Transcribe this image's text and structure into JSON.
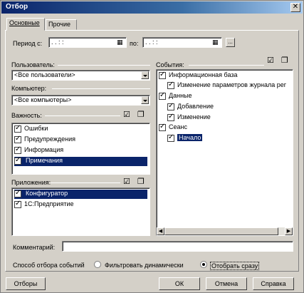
{
  "window": {
    "title": "Отбор"
  },
  "tabs": [
    {
      "label": "Основные"
    },
    {
      "label": "Прочие"
    }
  ],
  "period": {
    "from_label": "Период с:",
    "from_value": ". .      :  :",
    "to_label": "по:",
    "to_value": ". .      :  :",
    "more_button": "..."
  },
  "user": {
    "label": "Пользователь:",
    "value": "<Все пользователи>"
  },
  "computer": {
    "label": "Компьютер:",
    "value": "<Все компьютеры>"
  },
  "importance": {
    "label": "Важность:",
    "items": [
      {
        "label": "Ошибки",
        "checked": true
      },
      {
        "label": "Предупреждения",
        "checked": true
      },
      {
        "label": "Информация",
        "checked": true
      },
      {
        "label": "Примечания",
        "checked": true,
        "selected": true
      }
    ]
  },
  "applications": {
    "label": "Приложения:",
    "items": [
      {
        "label": "Конфигуратор",
        "checked": true,
        "selected": true
      },
      {
        "label": "1С:Предприятие",
        "checked": true
      }
    ]
  },
  "events": {
    "label": "События:",
    "items": [
      {
        "label": "Информационная база",
        "checked": true,
        "level": 0
      },
      {
        "label": "Изменение параметров журнала рег",
        "checked": true,
        "level": 1
      },
      {
        "label": "Данные",
        "checked": true,
        "level": 0
      },
      {
        "label": "Добавление",
        "checked": true,
        "level": 1
      },
      {
        "label": "Изменение",
        "checked": true,
        "level": 1
      },
      {
        "label": "Сеанс",
        "checked": true,
        "level": 0
      },
      {
        "label": "Начало",
        "checked": true,
        "level": 1,
        "selected": true
      }
    ]
  },
  "comment": {
    "label": "Комментарий:",
    "value": ""
  },
  "filter_method": {
    "label": "Способ отбора событий",
    "option_dynamic": "Фильтровать динамически",
    "option_immediate": "Отобрать сразу",
    "selected": "immediate"
  },
  "buttons": {
    "filters": "Отборы",
    "ok": "ОК",
    "cancel": "Отмена",
    "help": "Справка"
  }
}
